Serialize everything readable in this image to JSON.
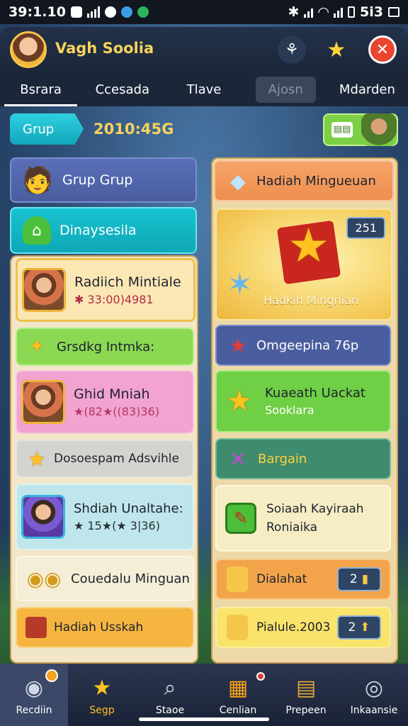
{
  "status_bar": {
    "time": "39:1.10",
    "battery": "5i3"
  },
  "header": {
    "username": "Vagh Soolia"
  },
  "tabs": [
    "Bsrara",
    "Ccesada",
    "Tlave",
    "Ajosn",
    "Mdarden"
  ],
  "grup": {
    "label": "Grup",
    "value": "2010:45G"
  },
  "left": {
    "group_card": "Grup Grup",
    "section_card": "Dinaysesila",
    "reward_title": "Radiich Mintiale",
    "reward_sub": "33:00)4981",
    "badge_title": "Grsdkg Intmka:",
    "person_title": "Ghid Mniah",
    "person_sub": "★(82★((83)36)",
    "promo_title": "Dosoespam Adsvihle",
    "shdiah_title": "Shdiah Unaltahe:",
    "shdiah_sub": "★ 15★(★ 3|36)",
    "coins_title": "Couedalu Minguan",
    "hadiah_title": "Hadiah Usskah"
  },
  "right": {
    "weekly_title": "Hadiah Mingueuan",
    "chest_badge": "251",
    "chest_caption": "Hadkih Mingnian",
    "ongoing_title": "Omgeepina 76p",
    "kuaeth_title": "Kuaeath Uackat",
    "kuaeth_sub": "Sooklara",
    "bargain_title": "Bargain",
    "soiaah_title": "Soiaah Kayiraah",
    "soiaah_sub": "Roniaika",
    "dialahat_title": "Dialahat",
    "dialahat_count": "2",
    "pialule_title": "Pialule.2003",
    "pialule_count": "2"
  },
  "bottom_nav": [
    {
      "label": "Recdiin",
      "icon": "profile-icon"
    },
    {
      "label": "Segp",
      "icon": "star-icon"
    },
    {
      "label": "Staoe",
      "icon": "search-icon"
    },
    {
      "label": "Cenlian",
      "icon": "calendar-icon"
    },
    {
      "label": "Prepeen",
      "icon": "books-icon"
    },
    {
      "label": "Inkaansie",
      "icon": "camera-icon"
    }
  ],
  "colors": {
    "accent_yellow": "#f7d35a",
    "close_red": "#e9452f",
    "teal": "#1bb3c7",
    "green": "#7cd045"
  }
}
